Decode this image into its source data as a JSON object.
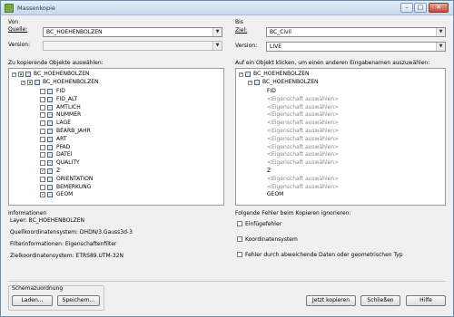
{
  "window": {
    "title": "Massenkopie",
    "min_label": "–",
    "max_label": "□",
    "close_label": "✕"
  },
  "von": {
    "header": "Von",
    "quelle_label": "Quelle:",
    "quelle_value": "BC_HOEHENBOLZEN",
    "version_label": "Version:",
    "version_value": ""
  },
  "bis": {
    "header": "Bis",
    "ziel_label": "Ziel:",
    "ziel_value": "BC_Civil",
    "version_label": "Version:",
    "version_value": "LIVE"
  },
  "left_tree": {
    "caption": "Zu kopierende Objekte auswählen:",
    "root": "BC_HOEHENBOLZEN",
    "child": "BC_HOEHENBOLZEN",
    "fields": [
      "FID",
      "FID_ALT",
      "AMTLICH",
      "NUMMER",
      "LAGE",
      "BEARB_JAHR",
      "ART",
      "PFAD",
      "DATEI",
      "QUALITY",
      "Z",
      "ORIENTATION",
      "BEMERKUNG",
      "GEOM"
    ],
    "checked": [
      false,
      false,
      false,
      false,
      false,
      false,
      false,
      false,
      false,
      false,
      true,
      false,
      false,
      true
    ]
  },
  "right_tree": {
    "caption": "Auf ein Objekt klicken, um einen anderen Eingabenamen auszuwählen:",
    "root": "BC_HOEHENBOLZEN",
    "child": "BC_HOEHENBOLZEN",
    "fields": [
      "FID",
      "<Eigenschaft auswählen>",
      "<Eigenschaft auswählen>",
      "<Eigenschaft auswählen>",
      "<Eigenschaft auswählen>",
      "<Eigenschaft auswählen>",
      "<Eigenschaft auswählen>",
      "<Eigenschaft auswählen>",
      "<Eigenschaft auswählen>",
      "<Eigenschaft auswählen>",
      "Z",
      "<Eigenschaft auswählen>",
      "<Eigenschaft auswählen>",
      "GEOM"
    ]
  },
  "info": {
    "header": "Informationen",
    "layer": "Layer: BC_HOEHENBOLZEN",
    "quell_ks": "Quellkoordinatensystem: DHDN/3.Gauss3d-3",
    "filter": "Filterinformationen: Eigenschaftenfilter",
    "ziel_ks": "Zielkoordinatensystem: ETRS89.UTM-32N"
  },
  "ignore": {
    "header": "Folgende Fehler beim Kopieren ignorieren:",
    "options": [
      "Einfügefehler",
      "Koordinatensystem",
      "Fehler durch abweichende Daten oder geometrischen Typ"
    ]
  },
  "schema": {
    "header": "Schemazuordnung",
    "laden": "Laden...",
    "speichern": "Speichern..."
  },
  "buttons": {
    "copy": "Jetzt kopieren",
    "close": "Schließen",
    "help": "Hilfe"
  }
}
